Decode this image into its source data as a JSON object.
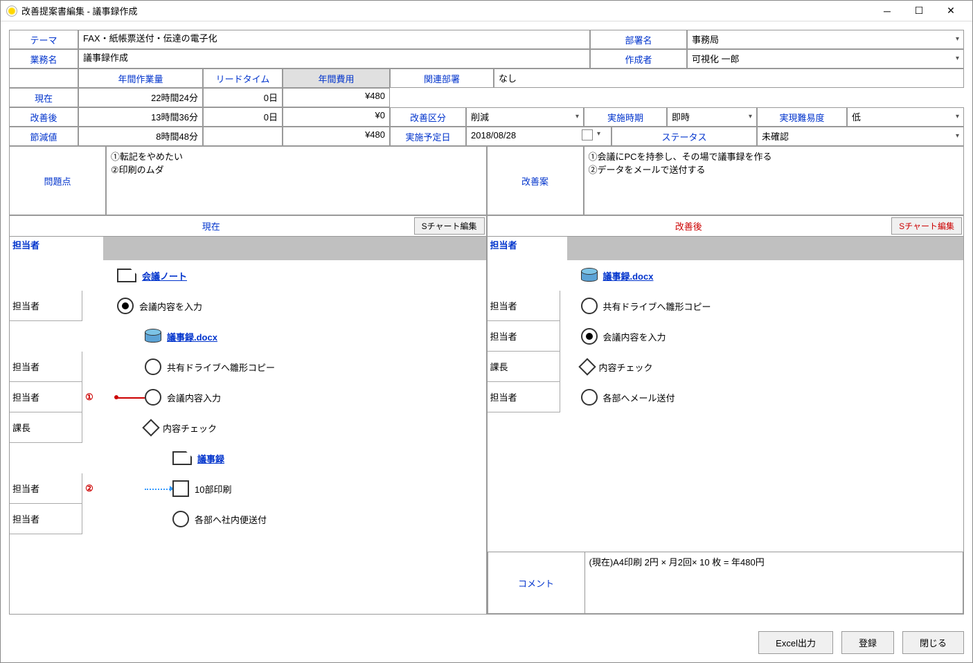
{
  "window": {
    "title": "改善提案書編集 - 議事録作成"
  },
  "header": {
    "theme_label": "テーマ",
    "theme_value": "FAX・紙帳票送付・伝達の電子化",
    "dept_label": "部署名",
    "dept_value": "事務局",
    "task_label": "業務名",
    "task_value": "議事録作成",
    "author_label": "作成者",
    "author_value": "可視化 一郎"
  },
  "metrics": {
    "col_workload": "年間作業量",
    "col_leadtime": "リードタイム",
    "col_cost": "年間費用",
    "row_current": "現在",
    "row_after": "改善後",
    "row_saving": "節減値",
    "current_workload": "22時間24分",
    "current_leadtime": "0日",
    "current_cost": "¥480",
    "after_workload": "13時間36分",
    "after_leadtime": "0日",
    "after_cost": "¥0",
    "saving_workload": "8時間48分",
    "saving_leadtime": "",
    "saving_cost": "¥480"
  },
  "related": {
    "label": "関連部署",
    "value": "なし"
  },
  "improve": {
    "kubun_label": "改善区分",
    "kubun_value": "削減",
    "jiki_label": "実施時期",
    "jiki_value": "即時",
    "nanido_label": "実現難易度",
    "nanido_value": "低",
    "yoteibi_label": "実施予定日",
    "yoteibi_value": "2018/08/28",
    "status_label": "ステータス",
    "status_value": "未確認"
  },
  "problem": {
    "label": "問題点",
    "value": "①転記をやめたい\n②印刷のムダ"
  },
  "plan": {
    "label": "改善案",
    "value": "①会議にPCを持参し、その場で議事録を作る\n②データをメールで送付する"
  },
  "chart_current": {
    "title": "現在",
    "btn": "Sチャート編集",
    "role_header": "担当者",
    "roles": [
      "",
      "担当者",
      "",
      "担当者",
      "担当者",
      "課長",
      "",
      "担当者",
      "担当者"
    ],
    "badges": [
      "",
      "",
      "",
      "",
      "①",
      "",
      "",
      "②",
      ""
    ],
    "items": [
      {
        "type": "doc",
        "label": "会議ノート",
        "link": true,
        "indent": 0
      },
      {
        "type": "circle_filled",
        "label": "会議内容を入力",
        "indent": 0
      },
      {
        "type": "db",
        "label": "議事録.docx",
        "link": true,
        "indent": 1
      },
      {
        "type": "circle",
        "label": "共有ドライブへ雛形コピー",
        "indent": 1
      },
      {
        "type": "circle",
        "label": "会議内容入力",
        "indent": 1,
        "red_line": true
      },
      {
        "type": "diamond",
        "label": "内容チェック",
        "indent": 1
      },
      {
        "type": "doc",
        "label": "議事録",
        "link": true,
        "indent": 2
      },
      {
        "type": "square",
        "label": "10部印刷",
        "indent": 2,
        "blue_dot": true
      },
      {
        "type": "circle",
        "label": "各部へ社内便送付",
        "indent": 2
      }
    ]
  },
  "chart_after": {
    "title": "改善後",
    "btn": "Sチャート編集",
    "role_header": "担当者",
    "roles": [
      "",
      "担当者",
      "担当者",
      "課長",
      "担当者"
    ],
    "items": [
      {
        "type": "db",
        "label": "議事録.docx",
        "link": true,
        "indent": 0
      },
      {
        "type": "circle",
        "label": "共有ドライブへ雛形コピー",
        "indent": 0
      },
      {
        "type": "circle_filled",
        "label": "会議内容を入力",
        "indent": 0
      },
      {
        "type": "diamond",
        "label": "内容チェック",
        "indent": 0
      },
      {
        "type": "circle",
        "label": "各部へメール送付",
        "indent": 0
      }
    ]
  },
  "comment": {
    "label": "コメント",
    "value": "(現在)A4印刷 2円 × 月2回× 10 枚 = 年480円"
  },
  "footer": {
    "excel": "Excel出力",
    "save": "登録",
    "close": "閉じる"
  }
}
